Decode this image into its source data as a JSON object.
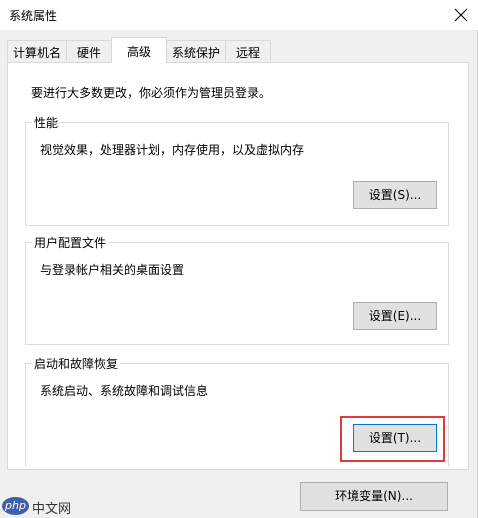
{
  "window": {
    "title": "系统属性",
    "close_icon": "close-icon"
  },
  "tabs": [
    {
      "label": "计算机名",
      "active": false
    },
    {
      "label": "硬件",
      "active": false
    },
    {
      "label": "高级",
      "active": true
    },
    {
      "label": "系统保护",
      "active": false
    },
    {
      "label": "远程",
      "active": false
    }
  ],
  "advanced": {
    "intro": "要进行大多数更改，你必须作为管理员登录。",
    "performance": {
      "label": "性能",
      "description": "视觉效果，处理器计划，内存使用，以及虚拟内存",
      "button": "设置(S)..."
    },
    "user_profiles": {
      "label": "用户配置文件",
      "description": "与登录帐户相关的桌面设置",
      "button": "设置(E)..."
    },
    "startup_recovery": {
      "label": "启动和故障恢复",
      "description": "系统启动、系统故障和调试信息",
      "button": "设置(T)..."
    },
    "env_button": "环境变量(N)..."
  },
  "annotation": {
    "highlight_color": "#e03a3a"
  },
  "watermark": {
    "logo": "php",
    "text": "中文网"
  }
}
